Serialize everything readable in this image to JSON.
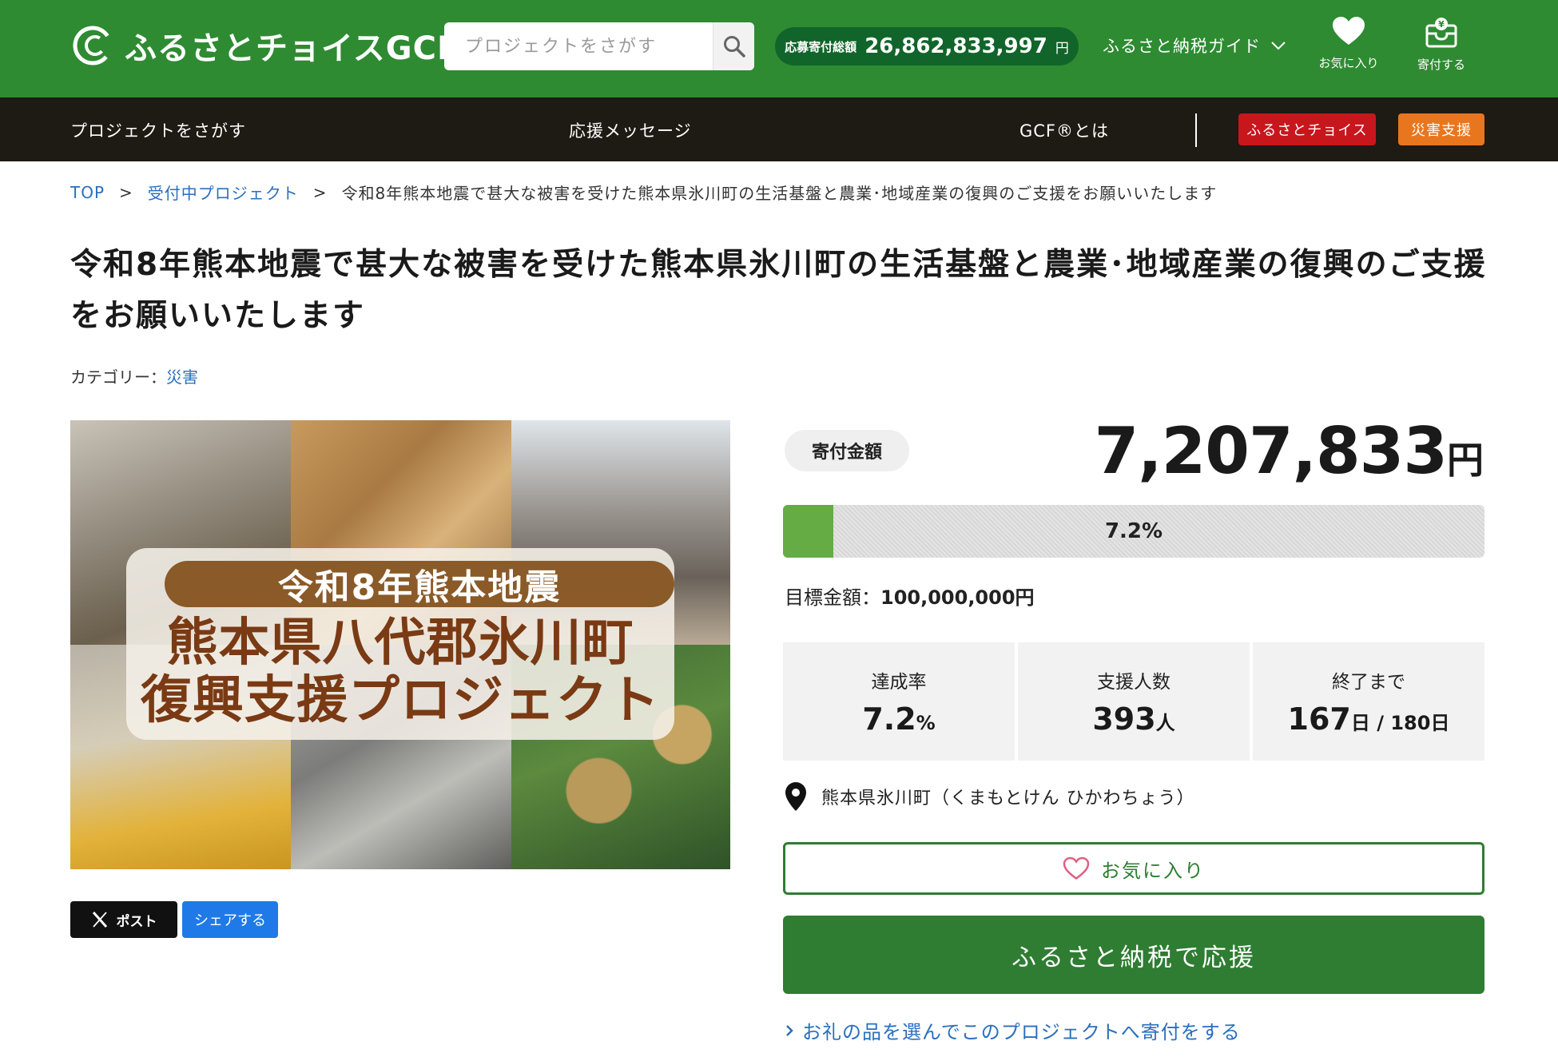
{
  "header": {
    "logo_text": "ふるさとチョイスGCF",
    "logo_reg": "®",
    "search": {
      "placeholder": "プロジェクトをさがす"
    },
    "total": {
      "label": "応募寄付総額",
      "value": "26,862,833,997",
      "unit": "円"
    },
    "guide_label": "ふるさと納税ガイド",
    "favorites_label": "お気に入り",
    "donate_label": "寄付する"
  },
  "nav": {
    "items": [
      "プロジェクトをさがす",
      "応援メッセージ",
      "GCF®とは"
    ],
    "badge_choice": "ふるさとチョイス",
    "badge_disaster": "災害支援"
  },
  "colors": {
    "brand_green": "#2e8b32",
    "nav_dark": "#1e1a14",
    "badge_red": "#c8161d",
    "badge_orange": "#e8761f",
    "progress_green": "#66ac45",
    "link_blue": "#2a6fbd"
  },
  "breadcrumb": {
    "top": "TOP",
    "sep": ">",
    "projects": "受付中プロジェクト",
    "current": "令和8年熊本地震で甚大な被害を受けた熊本県氷川町の生活基盤と農業･地域産業の復興のご支援をお願いいたします"
  },
  "project": {
    "title": "令和8年熊本地震で甚大な被害を受けた熊本県氷川町の生活基盤と農業･地域産業の復興のご支援をお願いいたします",
    "category_label": "カテゴリー：",
    "category_value": "災害"
  },
  "hero": {
    "line1": "令和8年熊本地震",
    "line2": "熊本県八代郡氷川町",
    "line3": "復興支援プロジェクト"
  },
  "share": {
    "x_label": "ポスト",
    "fb_label": "シェアする"
  },
  "funding": {
    "amount_label": "寄付金額",
    "amount_value": "7,207,833",
    "amount_unit": "円",
    "progress_percent": 7.2,
    "progress_text": "7.2%",
    "goal_label": "目標金額：",
    "goal_value": "100,000,000円"
  },
  "stats": {
    "rate_label": "達成率",
    "rate_value": "7.2",
    "rate_unit": "%",
    "supporters_label": "支援人数",
    "supporters_value": "393",
    "supporters_unit": "人",
    "remaining_label": "終了まで",
    "remaining_value": "167",
    "remaining_unit": "日",
    "remaining_sep": "/",
    "remaining_total": "180日"
  },
  "location": "熊本県氷川町（くまもとけん ひかわちょう）",
  "actions": {
    "favorite_label": "お気に入り",
    "support_label": "ふるさと納税で応援",
    "gift_link": "お礼の品を選んでこのプロジェクトへ寄付をする"
  },
  "icons": [
    "logo-mark",
    "search-icon",
    "chevron-down-icon",
    "heart-icon",
    "donate-box-icon",
    "x-logo-icon",
    "location-pin-icon",
    "heart-outline-icon",
    "chevron-right-icon"
  ]
}
